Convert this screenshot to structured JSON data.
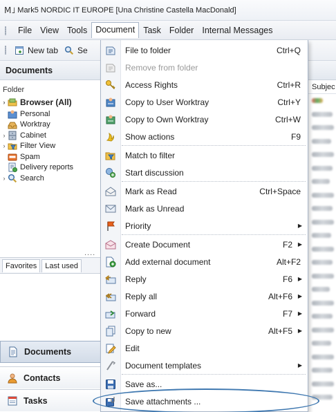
{
  "window": {
    "title": "Mark5 NORDIC IT EUROPE [Una Christine Castella MacDonald]"
  },
  "menubar": {
    "items": [
      "File",
      "View",
      "Tools",
      "Document",
      "Task",
      "Folder",
      "Internal Messages"
    ],
    "active": "Document"
  },
  "toolbar": {
    "new_tab": "New tab",
    "search_truncated": "Se"
  },
  "documents_pane": {
    "title": "Documents",
    "folder_label": "Folder",
    "tree": [
      {
        "label": "Browser (All)",
        "expander": "›",
        "icon": "browser-icon",
        "bold": true
      },
      {
        "label": "Personal",
        "expander": "",
        "icon": "personal-icon"
      },
      {
        "label": "Worktray",
        "expander": "",
        "icon": "worktray-icon"
      },
      {
        "label": "Cabinet",
        "expander": "›",
        "icon": "cabinet-icon"
      },
      {
        "label": "Filter View",
        "expander": "›",
        "icon": "filter-view-icon"
      },
      {
        "label": "Spam",
        "expander": "",
        "icon": "spam-icon"
      },
      {
        "label": "Delivery reports",
        "expander": "",
        "icon": "delivery-reports-icon"
      },
      {
        "label": "Search",
        "expander": "›",
        "icon": "search-icon"
      }
    ],
    "more": "....",
    "tabs": [
      "Favorites",
      "Last used"
    ]
  },
  "nav_buttons": [
    {
      "label": "Documents",
      "icon": "documents-icon",
      "active": true
    },
    {
      "label": "Contacts",
      "icon": "contacts-icon",
      "active": false
    },
    {
      "label": "Tasks",
      "icon": "tasks-icon",
      "active": false
    }
  ],
  "right_pane": {
    "column_header": "Subjec"
  },
  "document_menu": [
    {
      "label": "File to folder",
      "shortcut": "Ctrl+Q",
      "icon": "file-to-folder-icon"
    },
    {
      "label": "Remove from folder",
      "shortcut": "",
      "icon": "remove-from-folder-icon",
      "disabled": true
    },
    {
      "label": "Access Rights",
      "shortcut": "Ctrl+R",
      "icon": "access-rights-icon"
    },
    {
      "label": "Copy to User Worktray",
      "shortcut": "Ctrl+Y",
      "icon": "copy-to-user-worktray-icon"
    },
    {
      "label": "Copy to Own Worktray",
      "shortcut": "Ctrl+W",
      "icon": "copy-to-own-worktray-icon"
    },
    {
      "label": "Show actions",
      "shortcut": "F9",
      "icon": "show-actions-icon",
      "sep_after": true
    },
    {
      "label": "Match to filter",
      "shortcut": "",
      "icon": "match-to-filter-icon"
    },
    {
      "label": "Start discussion",
      "shortcut": "",
      "icon": "start-discussion-icon",
      "sep_after": true
    },
    {
      "label": "Mark as Read",
      "shortcut": "Ctrl+Space",
      "icon": "mark-as-read-icon"
    },
    {
      "label": "Mark as Unread",
      "shortcut": "",
      "icon": "mark-as-unread-icon"
    },
    {
      "label": "Priority",
      "shortcut": "",
      "icon": "priority-icon",
      "submenu": true,
      "sep_after": true
    },
    {
      "label": "Create Document",
      "shortcut": "F2",
      "icon": "create-document-icon",
      "submenu": true
    },
    {
      "label": "Add external document",
      "shortcut": "Alt+F2",
      "icon": "add-external-document-icon"
    },
    {
      "label": "Reply",
      "shortcut": "F6",
      "icon": "reply-icon",
      "submenu": true
    },
    {
      "label": "Reply all",
      "shortcut": "Alt+F6",
      "icon": "reply-all-icon",
      "submenu": true
    },
    {
      "label": "Forward",
      "shortcut": "F7",
      "icon": "forward-icon",
      "submenu": true
    },
    {
      "label": "Copy to new",
      "shortcut": "Alt+F5",
      "icon": "copy-to-new-icon",
      "submenu": true
    },
    {
      "label": "Edit",
      "shortcut": "",
      "icon": "edit-icon"
    },
    {
      "label": "Document templates",
      "shortcut": "",
      "icon": "document-templates-icon",
      "submenu": true,
      "sep_after": true
    },
    {
      "label": "Save as...",
      "shortcut": "",
      "icon": "save-as-icon",
      "highlighted": true
    },
    {
      "label": "Save attachments ...",
      "shortcut": "",
      "icon": "save-attachments-icon"
    }
  ],
  "colors": {
    "accent": "#3f78b0",
    "menu_border": "#a9b6c8",
    "header_bg": "#e3e8ef"
  }
}
